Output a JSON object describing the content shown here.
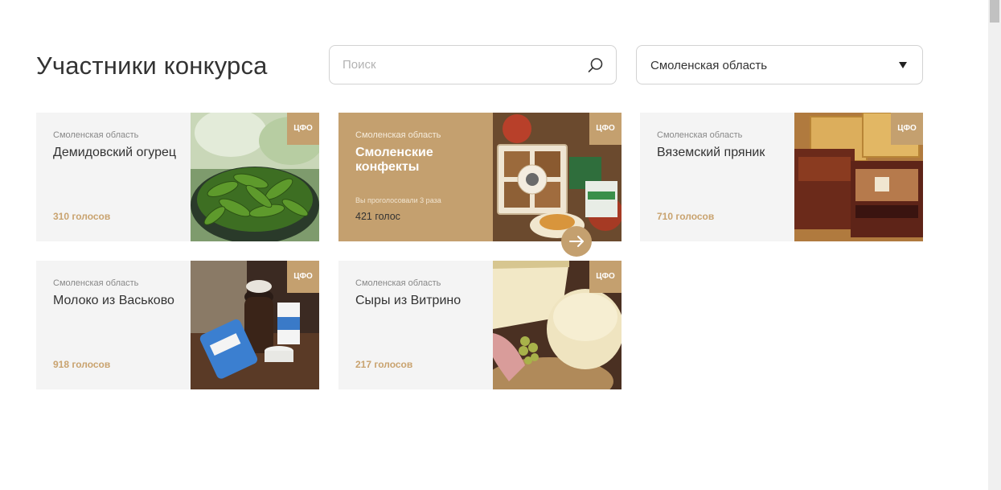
{
  "header": {
    "title": "Участники конкурса"
  },
  "search": {
    "placeholder": "Поиск",
    "value": "",
    "icon": "search-icon"
  },
  "filter": {
    "selected": "Смоленская область",
    "icon": "caret-down-icon"
  },
  "badge_label": "ЦФО",
  "colors": {
    "accent": "#c4a06f",
    "card_bg": "#f4f4f4",
    "votes": "#c9a36f"
  },
  "cards": [
    {
      "region": "Смоленская область",
      "name": "Демидовский огурец",
      "votes": "310 голосов",
      "image": "cucumbers"
    },
    {
      "region": "Смоленская область",
      "name": "Смоленские конфекты",
      "voted_note": "Вы проголосовали 3 раза",
      "votes": "421 голос",
      "image": "candy-box",
      "active": true
    },
    {
      "region": "Смоленская область",
      "name": "Вяземский пряник",
      "votes": "710 голосов",
      "image": "gingerbread"
    },
    {
      "region": "Смоленская область",
      "name": "Молоко из Васьково",
      "votes": "918 голосов",
      "image": "milk"
    },
    {
      "region": "Смоленская область",
      "name": "Сыры из Витрино",
      "votes": "217 голосов",
      "image": "cheese"
    }
  ],
  "next_button": {
    "icon": "arrow-right-icon"
  }
}
